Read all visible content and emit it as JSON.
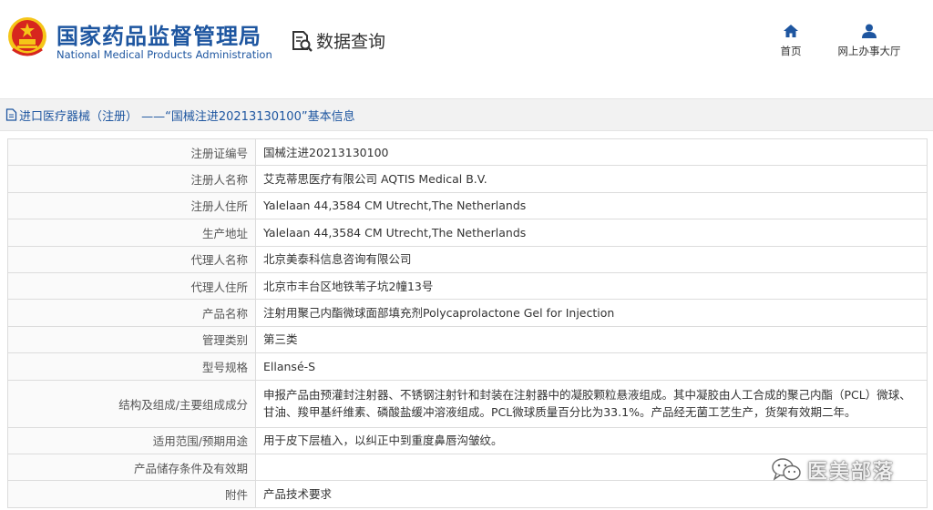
{
  "header": {
    "brand_cn": "国家药品监督管理局",
    "brand_en": "National Medical Products Administration",
    "query_label": "数据查询",
    "nav": [
      {
        "label": "首页",
        "icon": "home-icon"
      },
      {
        "label": "网上办事大厅",
        "icon": "user-icon"
      }
    ]
  },
  "breadcrumb": {
    "icon": "document-icon",
    "text": "进口医疗器械（注册） ——“国械注进20213130100”基本信息"
  },
  "details": {
    "rows": [
      {
        "label": "注册证编号",
        "value": "国械注进20213130100"
      },
      {
        "label": "注册人名称",
        "value": "艾克蒂思医疗有限公司 AQTIS Medical B.V."
      },
      {
        "label": "注册人住所",
        "value": "Yalelaan 44,3584 CM Utrecht,The Netherlands"
      },
      {
        "label": "生产地址",
        "value": "Yalelaan 44,3584 CM Utrecht,The Netherlands"
      },
      {
        "label": "代理人名称",
        "value": "北京美泰科信息咨询有限公司"
      },
      {
        "label": "代理人住所",
        "value": "北京市丰台区地铁苇子坑2幢13号"
      },
      {
        "label": "产品名称",
        "value": "注射用聚己内酯微球面部填充剂Polycaprolactone Gel for Injection"
      },
      {
        "label": "管理类别",
        "value": "第三类"
      },
      {
        "label": "型号规格",
        "value": "Ellansé-S"
      },
      {
        "label": "结构及组成/主要组成成分",
        "value": "申报产品由预灌封注射器、不锈钢注射针和封装在注射器中的凝胶颗粒悬液组成。其中凝胶由人工合成的聚己内酯（PCL）微球、甘油、羧甲基纤维素、磷酸盐缓冲溶液组成。PCL微球质量百分比为33.1%。产品经无菌工艺生产，货架有效期二年。"
      },
      {
        "label": "适用范围/预期用途",
        "value": "用于皮下层植入，以纠正中到重度鼻唇沟皱纹。"
      },
      {
        "label": "产品储存条件及有效期",
        "value": ""
      },
      {
        "label": "附件",
        "value": "产品技术要求"
      }
    ]
  },
  "watermark": {
    "text": "医美部落",
    "icon": "wechat-icon"
  },
  "colors": {
    "brand": "#1e56a0",
    "emblem_red": "#d7261e",
    "emblem_gold": "#f5c518"
  }
}
